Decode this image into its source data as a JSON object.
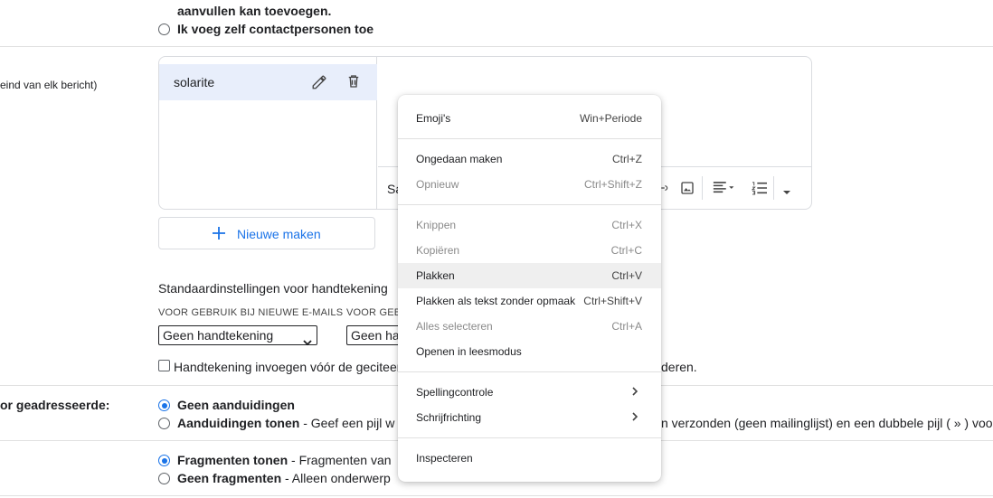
{
  "contacts": {
    "text_line1": "aanvullen kan toevoegen.",
    "option_self": "Ik voeg zelf contactpersonen toe"
  },
  "signature": {
    "left_label": "eind van elk bericht)",
    "items": [
      {
        "label": "solarite"
      }
    ],
    "toolbar_partial": "Sa",
    "new_button": "Nieuwe maken",
    "defaults_title": "Standaardinstellingen voor handtekening",
    "new_emails_label": "VOOR GEBRUIK BIJ NIEUWE E-MAILS",
    "reply_label": "VOOR GEB",
    "new_emails_value": "Geen handtekening",
    "reply_value": "Geen ha",
    "insert_checkbox_text": "Handtekening invoegen vóór de geciteerde",
    "insert_checkbox_tail": "deren."
  },
  "indicators": {
    "left_label": "or geadresseerde:",
    "option_none": "Geen aanduidingen",
    "option_show_bold": "Aanduidingen tonen",
    "option_show_rest": " - Geef een pijl w",
    "option_show_tail": "n verzonden (geen mailinglijst) en een dubbele pijl ( » ) voo"
  },
  "snippets": {
    "option_show_bold": "Fragmenten tonen",
    "option_show_rest": " - Fragmenten van",
    "option_none_bold": "Geen fragmenten",
    "option_none_rest": " - Alleen onderwerp"
  },
  "context_menu": {
    "groups": [
      [
        {
          "label": "Emoji's",
          "shortcut": "Win+Periode",
          "disabled": false
        }
      ],
      [
        {
          "label": "Ongedaan maken",
          "shortcut": "Ctrl+Z",
          "disabled": false
        },
        {
          "label": "Opnieuw",
          "shortcut": "Ctrl+Shift+Z",
          "disabled": true
        }
      ],
      [
        {
          "label": "Knippen",
          "shortcut": "Ctrl+X",
          "disabled": true
        },
        {
          "label": "Kopiëren",
          "shortcut": "Ctrl+C",
          "disabled": true
        },
        {
          "label": "Plakken",
          "shortcut": "Ctrl+V",
          "disabled": false,
          "hover": true
        },
        {
          "label": "Plakken als tekst zonder opmaak",
          "shortcut": "Ctrl+Shift+V",
          "disabled": false
        },
        {
          "label": "Alles selecteren",
          "shortcut": "Ctrl+A",
          "disabled": true
        },
        {
          "label": "Openen in leesmodus",
          "shortcut": "",
          "disabled": false
        }
      ],
      [
        {
          "label": "Spellingcontrole",
          "shortcut": "",
          "disabled": false,
          "submenu": true
        },
        {
          "label": "Schrijfrichting",
          "shortcut": "",
          "disabled": false,
          "submenu": true
        }
      ],
      [
        {
          "label": "Inspecteren",
          "shortcut": "",
          "disabled": false
        }
      ]
    ]
  },
  "colors": {
    "accent": "#1a73e8",
    "selected_bg": "#e8eefb",
    "menu_hover": "#efefef"
  }
}
